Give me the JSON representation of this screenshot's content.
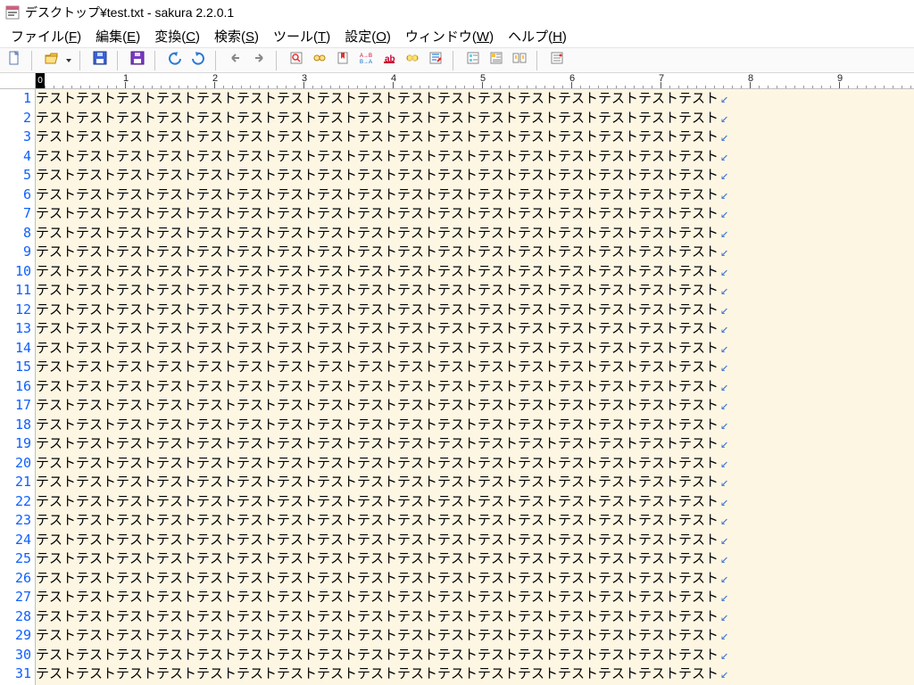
{
  "title": "デスクトップ¥test.txt - sakura 2.2.0.1",
  "menus": [
    {
      "label": "ファイル",
      "mn": "F"
    },
    {
      "label": "編集",
      "mn": "E"
    },
    {
      "label": "変換",
      "mn": "C"
    },
    {
      "label": "検索",
      "mn": "S"
    },
    {
      "label": "ツール",
      "mn": "T"
    },
    {
      "label": "設定",
      "mn": "O"
    },
    {
      "label": "ウィンドウ",
      "mn": "W"
    },
    {
      "label": "ヘルプ",
      "mn": "H"
    }
  ],
  "toolbar_icons": [
    "new-file-icon",
    "sep",
    "open-icon",
    "dropdown-icon",
    "sep",
    "save-icon",
    "sep",
    "save-all-icon",
    "sep",
    "undo-icon",
    "redo-icon",
    "sep",
    "back-icon",
    "forward-icon",
    "sep",
    "find-icon",
    "find-next-icon",
    "bookmark-toggle-icon",
    "replace-icon",
    "mark-icon",
    "highlight-icon",
    "jump-icon",
    "sep",
    "outline-icon",
    "type-list-icon",
    "compare-icon",
    "sep",
    "options-icon"
  ],
  "ruler": {
    "zero": "0",
    "majors": [
      1,
      2,
      3,
      4,
      5,
      6,
      7,
      8,
      9
    ],
    "minor_interval": 1
  },
  "editor": {
    "line_count": 31,
    "line_text": "テストテストテストテストテストテストテストテストテストテストテストテストテストテストテストテストテスト",
    "eol_glyph": "↙"
  }
}
